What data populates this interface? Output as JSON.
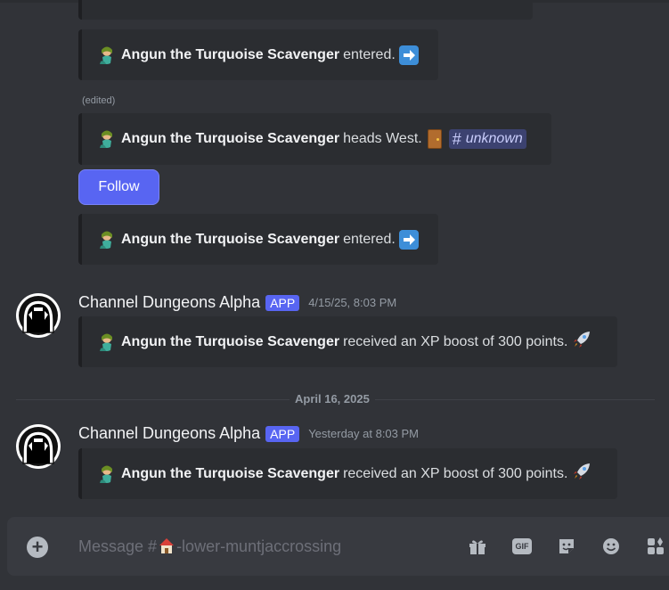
{
  "colors": {
    "background": "#313338",
    "embed_bg": "#2b2d31",
    "accent": "#5865f2",
    "mention_bg": "#3c4270",
    "muted": "#949ba4"
  },
  "feed": {
    "embeds": [
      {
        "name": "Angun the Turquoise Scavenger",
        "action": "entered.",
        "emoji": "arrow-right-icon"
      },
      {
        "name": "Angun the Turquoise Scavenger",
        "action": "heads West.",
        "emoji": "door-icon",
        "channel": "unknown",
        "edited_label": "(edited)"
      },
      {
        "name": "Angun the Turquoise Scavenger",
        "action": "entered.",
        "emoji": "arrow-right-icon"
      }
    ],
    "follow_label": "Follow",
    "messages": [
      {
        "author": "Channel Dungeons Alpha",
        "badge": "APP",
        "timestamp": "4/15/25, 8:03 PM",
        "embed": {
          "name": "Angun the Turquoise Scavenger",
          "action": "received an XP boost of 300 points.",
          "emoji": "rocket-icon"
        }
      },
      {
        "author": "Channel Dungeons Alpha",
        "badge": "APP",
        "timestamp": "Yesterday at 8:03 PM",
        "embed": {
          "name": "Angun the Turquoise Scavenger",
          "action": "received an XP boost of 300 points.",
          "emoji": "rocket-icon"
        }
      }
    ],
    "date_divider": "April 16, 2025"
  },
  "composer": {
    "placeholder_prefix": "Message #",
    "placeholder_channel": "-lower-muntjaccrossing",
    "icons": [
      "gift-icon",
      "gif-icon",
      "sticker-icon",
      "emoji-icon",
      "apps-icon"
    ]
  }
}
